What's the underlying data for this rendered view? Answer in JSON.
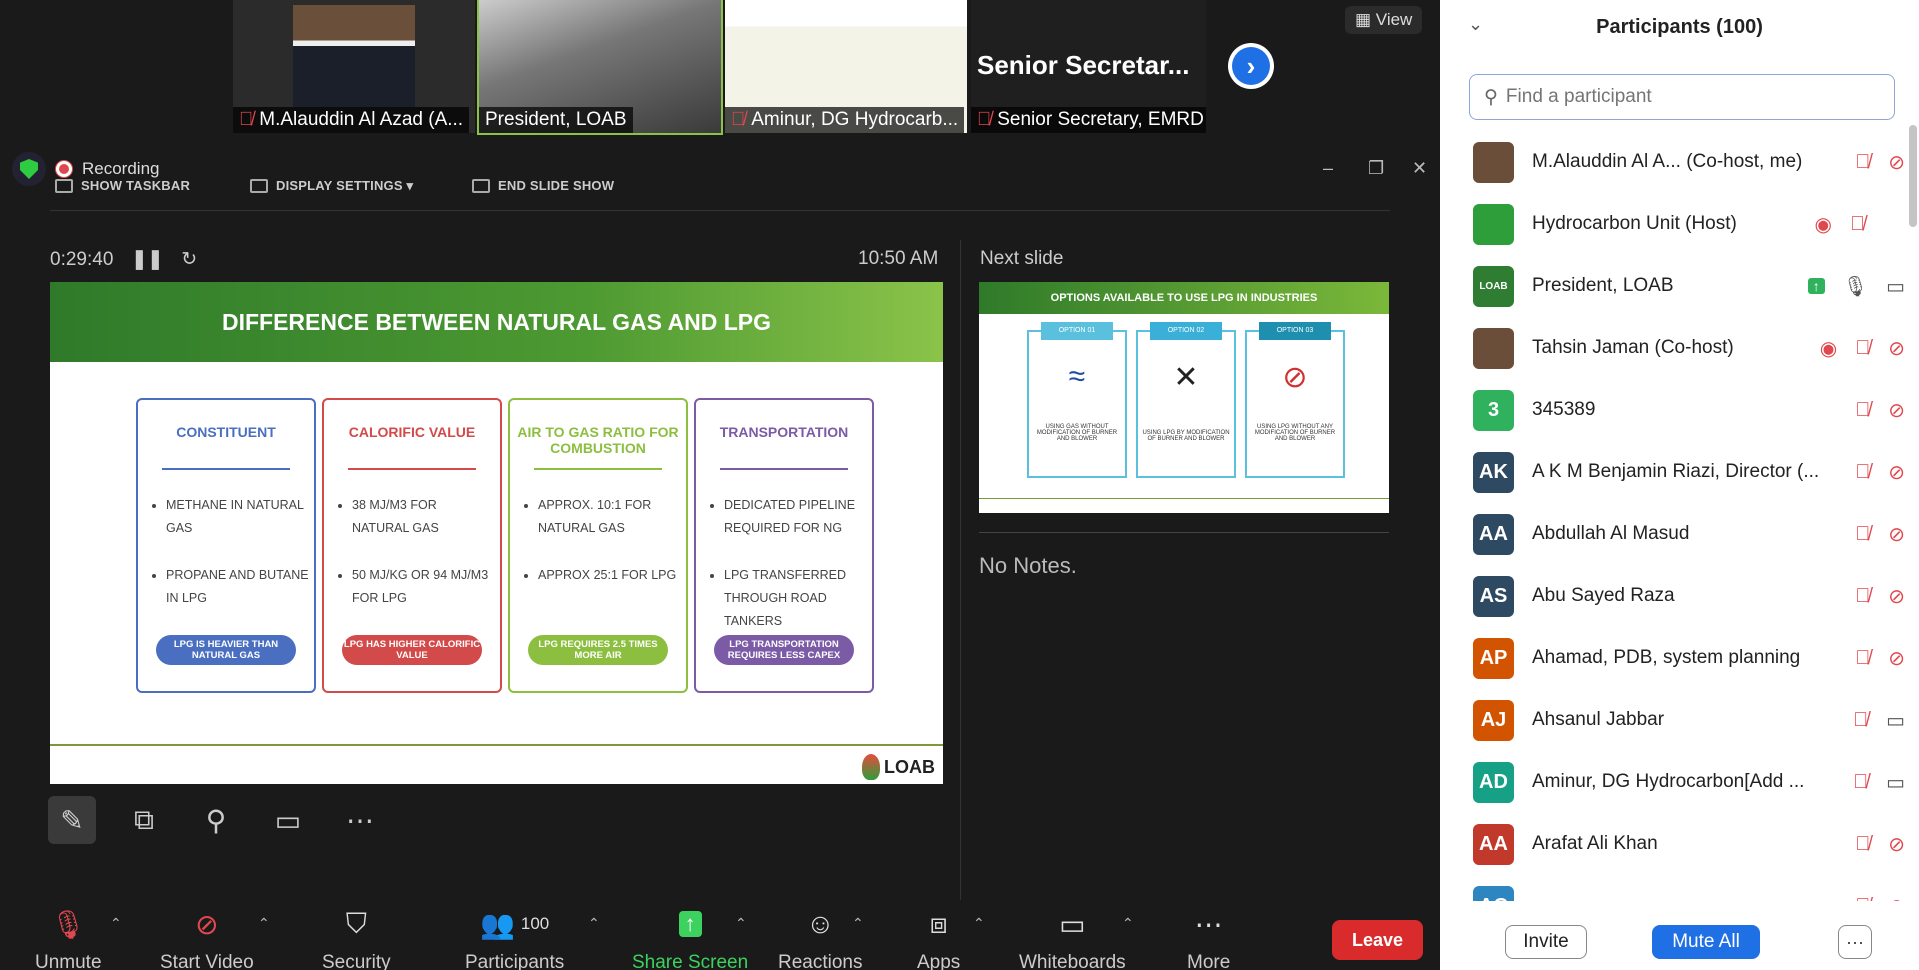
{
  "thumbnails": [
    {
      "name": "M.Alauddin Al Azad (A...",
      "muted": true
    },
    {
      "name": "President, LOAB",
      "muted": false
    },
    {
      "name": "Aminur, DG Hydrocarb...",
      "muted": true
    },
    {
      "name": "Senior Secretary, EMRD",
      "muted": true,
      "big_label": "Senior  Secretar..."
    }
  ],
  "view_label": "View",
  "recording_label": "Recording",
  "presenter": {
    "show_taskbar": "SHOW TASKBAR",
    "display_settings": "DISPLAY SETTINGS ▾",
    "end_slide_show": "END SLIDE SHOW",
    "elapsed": "0:29:40",
    "clock": "10:50 AM",
    "next_slide_label": "Next slide",
    "no_notes": "No Notes."
  },
  "slide": {
    "title": "DIFFERENCE BETWEEN NATURAL GAS AND LPG",
    "cards": [
      {
        "heading": "CONSTITUENT",
        "color": "#4a6fc0",
        "bullets": [
          "METHANE IN NATURAL GAS",
          "PROPANE AND BUTANE IN LPG"
        ],
        "pill": "LPG IS HEAVIER THAN NATURAL GAS"
      },
      {
        "heading": "CALORIFIC VALUE",
        "color": "#d24a4a",
        "bullets": [
          "38 MJ/M3 FOR NATURAL GAS",
          "50 MJ/KG OR 94 MJ/M3 FOR LPG"
        ],
        "pill": "LPG HAS HIGHER CALORIFIC VALUE"
      },
      {
        "heading": "AIR TO GAS RATIO FOR COMBUSTION",
        "color": "#8cbf3f",
        "bullets": [
          "APPROX. 10:1 FOR NATURAL GAS",
          "APPROX 25:1 FOR LPG"
        ],
        "pill": "LPG REQUIRES 2.5 TIMES MORE AIR"
      },
      {
        "heading": "TRANSPORTATION",
        "color": "#7b5aa6",
        "bullets": [
          "DEDICATED PIPELINE REQUIRED FOR NG",
          "LPG TRANSFERRED THROUGH ROAD TANKERS"
        ],
        "pill": "LPG TRANSPORTATION REQUIRES LESS CAPEX"
      }
    ],
    "logo": "LOAB"
  },
  "next_slide": {
    "title": "OPTIONS AVAILABLE TO USE LPG IN INDUSTRIES",
    "options": [
      {
        "tag": "OPTION 01",
        "desc": "USING GAS WITHOUT MODIFICATION OF BURNER AND BLOWER"
      },
      {
        "tag": "OPTION 02",
        "desc": "USING LPG BY MODIFICATION OF BURNER AND BLOWER"
      },
      {
        "tag": "OPTION 03",
        "desc": "USING LPG WITHOUT ANY MODIFICATION OF BURNER AND BLOWER"
      }
    ]
  },
  "toolbar": {
    "unmute": "Unmute",
    "start_video": "Start Video",
    "security": "Security",
    "participants": "Participants",
    "participants_count": "100",
    "share_screen": "Share Screen",
    "reactions": "Reactions",
    "apps": "Apps",
    "whiteboards": "Whiteboards",
    "more": "More",
    "leave": "Leave"
  },
  "sidebar": {
    "title": "Participants (100)",
    "search_placeholder": "Find a participant",
    "participants": [
      {
        "name": "M.Alauddin Al A...  (Co-host, me)",
        "initials": "",
        "color": "#6b4e3a",
        "photo": true,
        "rec": false,
        "mic": "muted",
        "video": "off"
      },
      {
        "name": "Hydrocarbon Unit (Host)",
        "initials": "",
        "color": "#2e9e3a",
        "photo": true,
        "rec": true,
        "mic": "muted",
        "video": "none"
      },
      {
        "name": "President, LOAB",
        "initials": "LOAB",
        "color": "#2e7d32",
        "photo": true,
        "share": true,
        "rec": false,
        "mic": "on",
        "video": "on"
      },
      {
        "name": "Tahsin Jaman (Co-host)",
        "initials": "",
        "color": "#6b4e3a",
        "photo": true,
        "rec": true,
        "mic": "muted",
        "video": "off"
      },
      {
        "name": "345389",
        "initials": "3",
        "color": "#2fb15d",
        "rec": false,
        "mic": "muted",
        "video": "off"
      },
      {
        "name": "A K M Benjamin Riazi, Director (...",
        "initials": "AK",
        "color": "#2e4a62",
        "rec": false,
        "mic": "muted",
        "video": "off"
      },
      {
        "name": "Abdullah Al Masud",
        "initials": "AA",
        "color": "#2e4a62",
        "rec": false,
        "mic": "muted",
        "video": "off"
      },
      {
        "name": "Abu Sayed Raza",
        "initials": "AS",
        "color": "#2e4a62",
        "rec": false,
        "mic": "muted",
        "video": "off"
      },
      {
        "name": "Ahamad, PDB, system planning",
        "initials": "AP",
        "color": "#d35400",
        "rec": false,
        "mic": "muted",
        "video": "off"
      },
      {
        "name": "Ahsanul Jabbar",
        "initials": "AJ",
        "color": "#d35400",
        "rec": false,
        "mic": "muted",
        "video": "on"
      },
      {
        "name": "Aminur, DG Hydrocarbon[Add ...",
        "initials": "AD",
        "color": "#16a085",
        "rec": false,
        "mic": "muted",
        "video": "on"
      },
      {
        "name": "Arafat Ali Khan",
        "initials": "AA",
        "color": "#c0392b",
        "rec": false,
        "mic": "muted",
        "video": "off"
      },
      {
        "name": "",
        "initials": "AC",
        "color": "#2e86c1",
        "rec": false,
        "mic": "muted",
        "video": "off"
      }
    ],
    "invite": "Invite",
    "mute_all": "Mute All",
    "more_dots": "···"
  }
}
